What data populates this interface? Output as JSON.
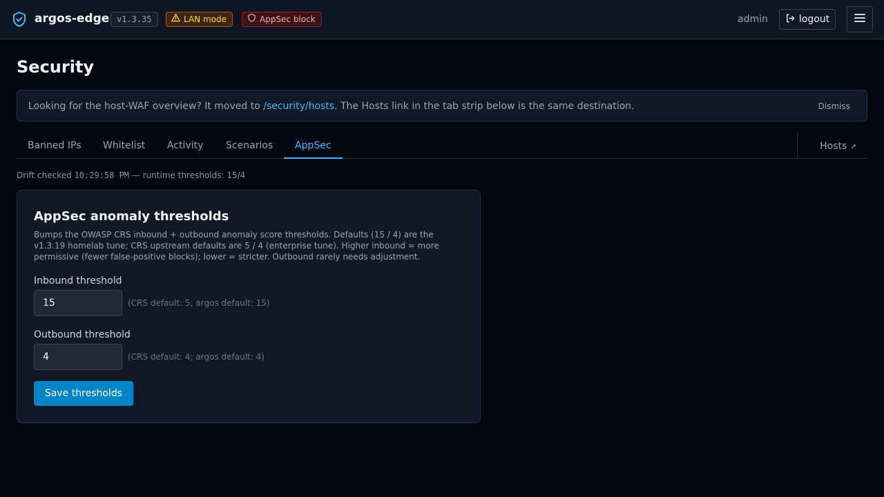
{
  "header": {
    "app_name": "argos-edge",
    "version": "v1.3.35",
    "badges": [
      {
        "label": "LAN mode",
        "icon": "warning-triangle-icon"
      },
      {
        "label": "AppSec block",
        "icon": "shield-icon"
      }
    ],
    "user": "admin",
    "logout_label": "logout",
    "colors": {
      "brand_icon": "#38bdf8",
      "lan_badge": "#fcd34d",
      "appsec_badge": "#fca5a5"
    }
  },
  "page": {
    "title": "Security"
  },
  "notice": {
    "text_before": "Looking for the host-WAF overview? It moved to ",
    "link": "/security/hosts",
    "text_after": ". The Hosts link in the tab strip below is the same destination.",
    "dismiss_label": "Dismiss"
  },
  "tabs": {
    "items": [
      {
        "label": "Banned IPs",
        "active": false
      },
      {
        "label": "Whitelist",
        "active": false
      },
      {
        "label": "Activity",
        "active": false
      },
      {
        "label": "Scenarios",
        "active": false
      },
      {
        "label": "AppSec",
        "active": true
      }
    ],
    "external": {
      "label": "Hosts",
      "icon": "external-arrow-icon"
    }
  },
  "drift": {
    "prefix": "Drift checked ",
    "time": "10:29:58 PM",
    "suffix": " — runtime thresholds: 15/4"
  },
  "card": {
    "title": "AppSec anomaly thresholds",
    "description": "Bumps the OWASP CRS inbound + outbound anomaly score thresholds. Defaults (15 / 4) are the v1.3.19 homelab tune; CRS upstream defaults are 5 / 4 (enterprise tune). Higher inbound = more permissive (fewer false-positive blocks); lower = stricter. Outbound rarely needs adjustment.",
    "inbound": {
      "label": "Inbound threshold",
      "value": "15",
      "hint": "(CRS default: 5; argos default: 15)"
    },
    "outbound": {
      "label": "Outbound threshold",
      "value": "4",
      "hint": "(CRS default: 4; argos default: 4)"
    },
    "save_label": "Save thresholds"
  },
  "accent_color": "#38bdf8",
  "primary_button_color": "#0284c7"
}
